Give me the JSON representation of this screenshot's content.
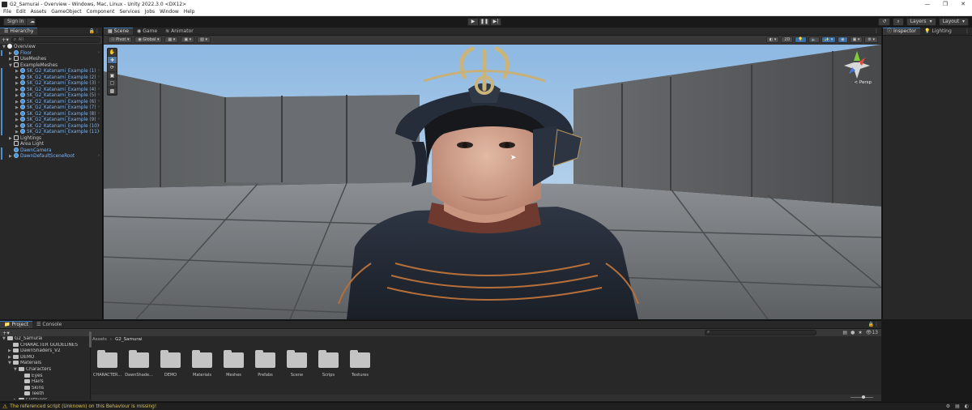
{
  "window": {
    "title": "G2_Samurai - Overview - Windows, Mac, Linux - Unity 2022.3.0 <DX12>"
  },
  "menu": [
    "File",
    "Edit",
    "Assets",
    "GameObject",
    "Component",
    "Services",
    "Jobs",
    "Window",
    "Help"
  ],
  "toolbar": {
    "signin": "Sign in",
    "layers": "Layers",
    "layout": "Layout"
  },
  "hierarchy": {
    "tab": "Hierarchy",
    "search_placeholder": "All",
    "items": [
      {
        "label": "Overview",
        "indent": 0,
        "arrow": "▼",
        "icon": "unity",
        "blue": false
      },
      {
        "label": "Floor",
        "indent": 1,
        "arrow": "▶",
        "icon": "go",
        "blue": true
      },
      {
        "label": "UseMeshes",
        "indent": 1,
        "arrow": "▶",
        "icon": "cube",
        "blue": false
      },
      {
        "label": "ExampleMeshes",
        "indent": 1,
        "arrow": "▼",
        "icon": "cube",
        "blue": false
      },
      {
        "label": "SK_G2_Katanami_Example (1)",
        "indent": 2,
        "arrow": "▶",
        "icon": "go",
        "blue": true
      },
      {
        "label": "SK_G2_Katanami_Example (2)",
        "indent": 2,
        "arrow": "▶",
        "icon": "go",
        "blue": true
      },
      {
        "label": "SK_G2_Katanami_Example (3)",
        "indent": 2,
        "arrow": "▶",
        "icon": "go",
        "blue": true
      },
      {
        "label": "SK_G2_Katanami_Example (4)",
        "indent": 2,
        "arrow": "▶",
        "icon": "go",
        "blue": true
      },
      {
        "label": "SK_G2_Katanami_Example (5)",
        "indent": 2,
        "arrow": "▶",
        "icon": "go",
        "blue": true
      },
      {
        "label": "SK_G2_Katanami_Example (6)",
        "indent": 2,
        "arrow": "▶",
        "icon": "go",
        "blue": true
      },
      {
        "label": "SK_G2_Katanami_Example (7)",
        "indent": 2,
        "arrow": "▶",
        "icon": "go",
        "blue": true
      },
      {
        "label": "SK_G2_Katanami_Example (8)",
        "indent": 2,
        "arrow": "▶",
        "icon": "go",
        "blue": true
      },
      {
        "label": "SK_G2_Katanami_Example (9)",
        "indent": 2,
        "arrow": "▶",
        "icon": "go",
        "blue": true
      },
      {
        "label": "SK_G2_Katanami_Example (10)",
        "indent": 2,
        "arrow": "▶",
        "icon": "go",
        "blue": true
      },
      {
        "label": "SK_G2_Katanami_Example (11)",
        "indent": 2,
        "arrow": "▶",
        "icon": "go",
        "blue": true
      },
      {
        "label": "Lightings",
        "indent": 1,
        "arrow": "▶",
        "icon": "cube",
        "blue": false
      },
      {
        "label": "Area Light",
        "indent": 1,
        "arrow": "",
        "icon": "cube",
        "blue": false
      },
      {
        "label": "DawnCamera",
        "indent": 1,
        "arrow": "",
        "icon": "go",
        "blue": true
      },
      {
        "label": "DawnDefaultSceneRoot",
        "indent": 1,
        "arrow": "▶",
        "icon": "go",
        "blue": true
      }
    ]
  },
  "scene": {
    "tabs": [
      "Scene",
      "Game",
      "Animator"
    ],
    "pivot": "Pivot",
    "global": "Global",
    "mode_2d": "2D",
    "persp": "< Persp"
  },
  "inspector": {
    "tabs": [
      "Inspector",
      "Lighting"
    ]
  },
  "project": {
    "tabs": [
      "Project",
      "Console"
    ],
    "badge_count": "13",
    "tree": [
      {
        "label": "G2_Samurai",
        "indent": 0,
        "arrow": "▼"
      },
      {
        "label": "CHARACTER GUIDELINES",
        "indent": 1,
        "arrow": ""
      },
      {
        "label": "DawnShaders_V2",
        "indent": 1,
        "arrow": "▶"
      },
      {
        "label": "DEMO",
        "indent": 1,
        "arrow": "▶"
      },
      {
        "label": "Materials",
        "indent": 1,
        "arrow": "▼"
      },
      {
        "label": "Characters",
        "indent": 2,
        "arrow": "▼"
      },
      {
        "label": "Eyes",
        "indent": 3,
        "arrow": ""
      },
      {
        "label": "Hairs",
        "indent": 3,
        "arrow": ""
      },
      {
        "label": "Skins",
        "indent": 3,
        "arrow": ""
      },
      {
        "label": "Teeth",
        "indent": 3,
        "arrow": ""
      },
      {
        "label": "Clothings",
        "indent": 2,
        "arrow": "▶"
      }
    ],
    "breadcrumb": [
      "Assets",
      "G2_Samurai"
    ],
    "folders": [
      "CHARACTER...",
      "DawnShade...",
      "DEMO",
      "Materials",
      "Meshes",
      "Prefabs",
      "Scene",
      "Scrips",
      "Textures"
    ]
  },
  "status": {
    "message": "The referenced script (Unknown) on this Behaviour is missing!"
  }
}
